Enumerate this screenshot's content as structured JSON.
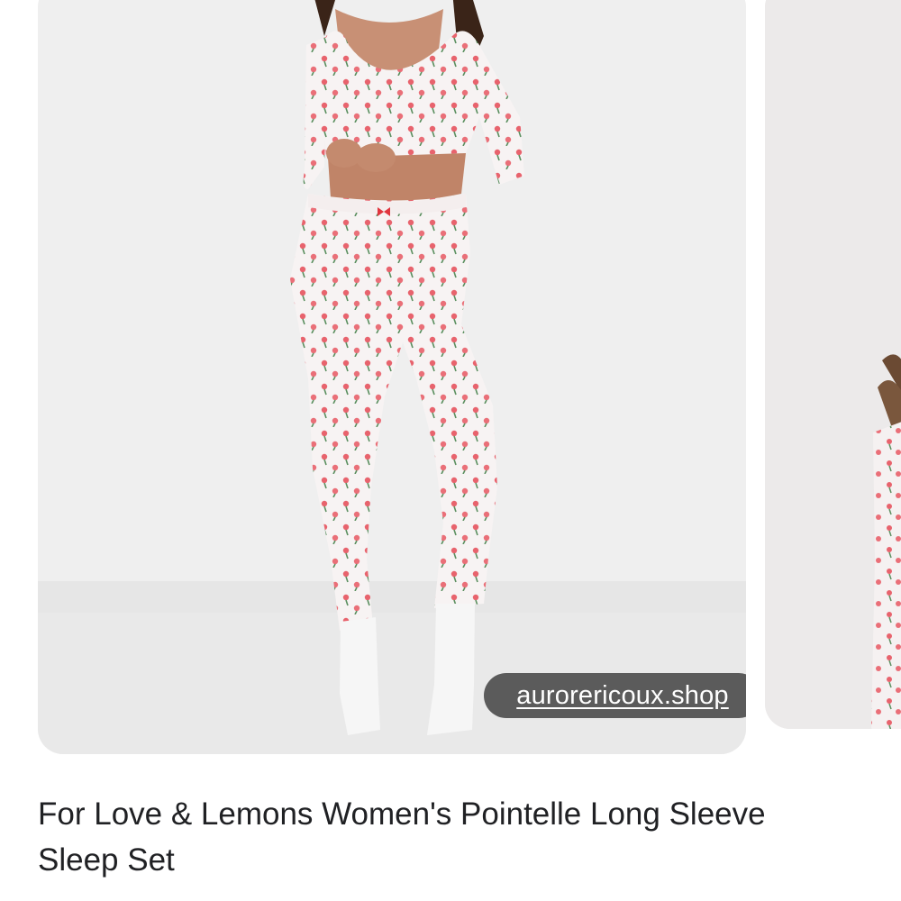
{
  "result": {
    "title": "For Love & Lemons Women's Pointelle Long Sleeve Sleep Set",
    "source": "aurorericoux.shop"
  },
  "colors": {
    "chip_background": "#3c3c3c",
    "title_text": "#202124",
    "print_flower": "#e8636d",
    "print_leaf": "#5a8f5f"
  }
}
